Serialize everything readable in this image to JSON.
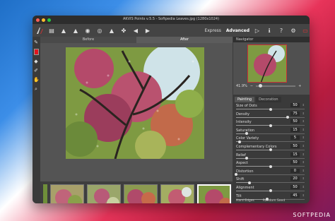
{
  "window": {
    "title": "AKVIS Points v.5.5 - Softpedia Leaves.jpg (1280x1024)"
  },
  "toolbar": {
    "express_label": "Express",
    "advanced_label": "Advanced"
  },
  "canvas": {
    "before_label": "Before",
    "after_label": "After"
  },
  "navigator": {
    "title": "Navigator",
    "zoom": "41.9%",
    "zoom_level": 0.1
  },
  "settings": {
    "tabs": [
      "Painting",
      "Decoration"
    ],
    "params": [
      {
        "label": "Size of Dots",
        "value": "50",
        "level": 0.5
      },
      {
        "label": "Density",
        "value": "75",
        "level": 0.75
      },
      {
        "label": "Intensity",
        "value": "50",
        "level": 0.5
      },
      {
        "label": "Saturation",
        "value": "15",
        "level": 0.15
      },
      {
        "label": "Color Variety",
        "value": "5",
        "level": 0.05
      },
      {
        "label": "Complementary Colors",
        "value": "50",
        "level": 0.5
      },
      {
        "label": "Relief",
        "value": "15",
        "level": 0.15
      },
      {
        "label": "Aspect",
        "value": "50",
        "level": 0.5
      },
      {
        "label": "Distortion",
        "value": "0",
        "level": 0.0
      },
      {
        "label": "Shift",
        "value": "20",
        "level": 0.2
      },
      {
        "label": "Alignment",
        "value": "50",
        "level": 0.5
      },
      {
        "label": "Tilt",
        "value": "45",
        "level": 0.45
      }
    ],
    "options": [
      "Hard Edges",
      "Random Seed"
    ]
  },
  "watermark": "SOFTPEDIA"
}
